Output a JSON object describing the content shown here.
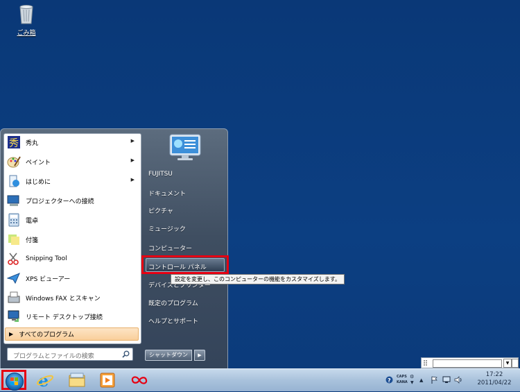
{
  "desktop": {
    "recycle_label": "ごみ箱"
  },
  "start_menu": {
    "programs": [
      {
        "label": "秀丸",
        "icon": "hidemaru-icon",
        "submenu": true
      },
      {
        "label": "ペイント",
        "icon": "paint-icon",
        "submenu": true
      },
      {
        "label": "はじめに",
        "icon": "getting-started-icon",
        "submenu": true
      },
      {
        "label": "プロジェクターへの接続",
        "icon": "projector-icon",
        "submenu": false
      },
      {
        "label": "電卓",
        "icon": "calculator-icon",
        "submenu": false
      },
      {
        "label": "付箋",
        "icon": "sticky-notes-icon",
        "submenu": false
      },
      {
        "label": "Snipping Tool",
        "icon": "snipping-tool-icon",
        "submenu": false
      },
      {
        "label": "XPS ビューアー",
        "icon": "xps-viewer-icon",
        "submenu": false
      },
      {
        "label": "Windows FAX とスキャン",
        "icon": "fax-scan-icon",
        "submenu": false
      },
      {
        "label": "リモート デスクトップ接続",
        "icon": "remote-desktop-icon",
        "submenu": false
      }
    ],
    "all_programs": "すべてのプログラム",
    "search_placeholder": "プログラムとファイルの検索",
    "right": {
      "fujitsu": "FUJITSU",
      "documents": "ドキュメント",
      "pictures": "ピクチャ",
      "music": "ミュージック",
      "computer": "コンピューター",
      "control_panel": "コントロール パネル",
      "devices": "デバイスとプリンター",
      "default_programs": "既定のプログラム",
      "help": "ヘルプとサポート"
    },
    "tooltip": "設定を変更し、このコンピューターの機能をカスタマイズします。",
    "shutdown": "シャットダウン"
  },
  "tray": {
    "caps": "CAPS",
    "kana": "KANA",
    "time": "17:22",
    "date": "2011/04/22"
  },
  "colors": {
    "highlight": "#e60012",
    "desktop": "#0b3a7a"
  }
}
